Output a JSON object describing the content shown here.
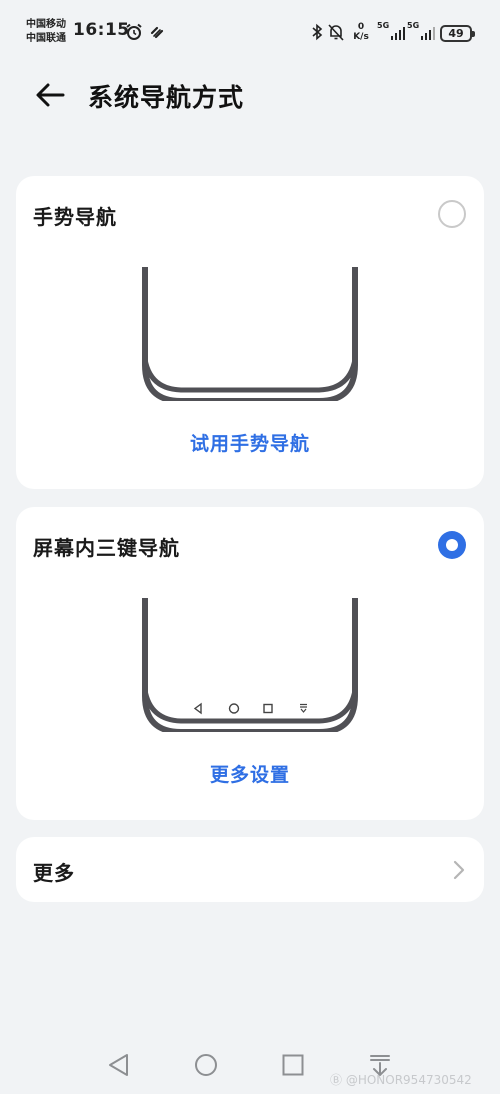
{
  "status_bar": {
    "carrier_1": "中国移动",
    "carrier_2": "中国联通",
    "time": "16:15",
    "speed_value": "0",
    "speed_unit": "K/s",
    "sim1_label": "5G",
    "sim2_label": "5G",
    "battery": "49"
  },
  "header": {
    "title": "系统导航方式"
  },
  "options": {
    "gesture": {
      "title": "手势导航",
      "selected": false,
      "link": "试用手势导航"
    },
    "three_key": {
      "title": "屏幕内三键导航",
      "selected": true,
      "link": "更多设置"
    }
  },
  "more": {
    "label": "更多"
  },
  "watermark": "Ⓑ @HONOR954730542",
  "colors": {
    "accent": "#2f6fe4",
    "background": "#f1f3f5",
    "card": "#ffffff",
    "phone_frame": "#505055"
  },
  "icons": {
    "back": "arrow-left-icon",
    "alarm": "alarm-clock-icon",
    "link": "link-icon",
    "bluetooth": "bluetooth-icon",
    "mute": "bell-off-icon",
    "chevron": "chevron-right-icon",
    "nav_back": "triangle-back-icon",
    "nav_home": "circle-home-icon",
    "nav_recent": "square-recent-icon",
    "nav_notify": "notification-pull-icon"
  }
}
